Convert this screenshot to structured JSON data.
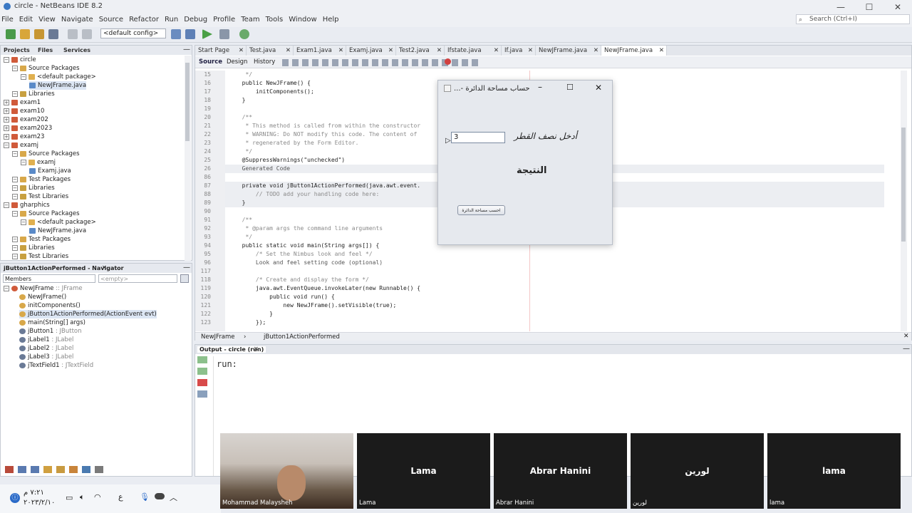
{
  "window": {
    "title": "circle - NetBeans IDE 8.2"
  },
  "menu": [
    "File",
    "Edit",
    "View",
    "Navigate",
    "Source",
    "Refactor",
    "Run",
    "Debug",
    "Profile",
    "Team",
    "Tools",
    "Window",
    "Help"
  ],
  "search": {
    "placeholder": "Search (Ctrl+I)"
  },
  "toolbar": {
    "config": "<default config>"
  },
  "projects_panel": {
    "tabs": [
      "Projects",
      "Files",
      "Services"
    ],
    "items": [
      {
        "label": "circle",
        "indent": 0,
        "icon": "project-icon"
      },
      {
        "label": "Source Packages",
        "indent": 1,
        "icon": "folder-icon"
      },
      {
        "label": "<default package>",
        "indent": 2,
        "icon": "package-icon"
      },
      {
        "label": "NewJFrame.java",
        "indent": 3,
        "icon": "java-file-icon",
        "selected": true
      },
      {
        "label": "Libraries",
        "indent": 1,
        "icon": "library-icon"
      },
      {
        "label": "exam1",
        "indent": 0,
        "icon": "project-icon"
      },
      {
        "label": "exam10",
        "indent": 0,
        "icon": "project-icon"
      },
      {
        "label": "exam202",
        "indent": 0,
        "icon": "project-icon"
      },
      {
        "label": "exam2023",
        "indent": 0,
        "icon": "project-icon"
      },
      {
        "label": "exam23",
        "indent": 0,
        "icon": "project-icon"
      },
      {
        "label": "examj",
        "indent": 0,
        "icon": "project-icon"
      },
      {
        "label": "Source Packages",
        "indent": 1,
        "icon": "folder-icon"
      },
      {
        "label": "examj",
        "indent": 2,
        "icon": "package-icon"
      },
      {
        "label": "Examj.java",
        "indent": 3,
        "icon": "java-file-icon"
      },
      {
        "label": "Test Packages",
        "indent": 1,
        "icon": "folder-icon"
      },
      {
        "label": "Libraries",
        "indent": 1,
        "icon": "library-icon"
      },
      {
        "label": "Test Libraries",
        "indent": 1,
        "icon": "library-icon"
      },
      {
        "label": "gharphics",
        "indent": 0,
        "icon": "project-icon"
      },
      {
        "label": "Source Packages",
        "indent": 1,
        "icon": "folder-icon"
      },
      {
        "label": "<default package>",
        "indent": 2,
        "icon": "package-icon"
      },
      {
        "label": "NewJFrame.java",
        "indent": 3,
        "icon": "java-file-icon"
      },
      {
        "label": "Test Packages",
        "indent": 1,
        "icon": "folder-icon"
      },
      {
        "label": "Libraries",
        "indent": 1,
        "icon": "library-icon"
      },
      {
        "label": "Test Libraries",
        "indent": 1,
        "icon": "library-icon"
      }
    ]
  },
  "navigator": {
    "title": "jButton1ActionPerformed - Navigator",
    "filter": "Members",
    "empty": "<empty>",
    "items": [
      {
        "label": "NewJFrame",
        "type": " :: JFrame",
        "indent": 0
      },
      {
        "label": "NewJFrame()",
        "type": "",
        "indent": 1
      },
      {
        "label": "initComponents()",
        "type": "",
        "indent": 1
      },
      {
        "label": "jButton1ActionPerformed(ActionEvent evt)",
        "type": "",
        "indent": 1,
        "selected": true
      },
      {
        "label": "main(String[] args)",
        "type": "",
        "indent": 1
      },
      {
        "label": "jButton1",
        "type": " : JButton",
        "indent": 1
      },
      {
        "label": "jLabel1",
        "type": " : JLabel",
        "indent": 1
      },
      {
        "label": "jLabel2",
        "type": " : JLabel",
        "indent": 1
      },
      {
        "label": "jLabel3",
        "type": " : JLabel",
        "indent": 1
      },
      {
        "label": "jTextField1",
        "type": " : JTextField",
        "indent": 1
      }
    ]
  },
  "editor": {
    "tabs": [
      "Start Page",
      "Test.java",
      "Exam1.java",
      "Examj.java",
      "Test2.java",
      "Ifstate.java",
      "If.java",
      "NewJFrame.java",
      "NewJFrame.java"
    ],
    "subtabs": [
      "Source",
      "Design",
      "History"
    ],
    "lines": [
      {
        "n": "15",
        "text": "   */"
      },
      {
        "n": "16",
        "text": "  public NewJFrame() {"
      },
      {
        "n": "17",
        "text": "      initComponents();"
      },
      {
        "n": "18",
        "text": "  }"
      },
      {
        "n": "19",
        "text": ""
      },
      {
        "n": "20",
        "text": "  /**"
      },
      {
        "n": "21",
        "text": "   * This method is called from within the constructor"
      },
      {
        "n": "22",
        "text": "   * WARNING: Do NOT modify this code. The content of"
      },
      {
        "n": "23",
        "text": "   * regenerated by the Form Editor."
      },
      {
        "n": "24",
        "text": "   */"
      },
      {
        "n": "25",
        "text": "  @SuppressWarnings(\"unchecked\")"
      },
      {
        "n": "26",
        "text": "  Generated Code"
      },
      {
        "n": "86",
        "text": ""
      },
      {
        "n": "87",
        "text": "  private void jButton1ActionPerformed(java.awt.event."
      },
      {
        "n": "88",
        "text": "      // TODO add your handling code here:"
      },
      {
        "n": "89",
        "text": "  }"
      },
      {
        "n": "90",
        "text": ""
      },
      {
        "n": "91",
        "text": "  /**"
      },
      {
        "n": "92",
        "text": "   * @param args the command line arguments"
      },
      {
        "n": "93",
        "text": "   */"
      },
      {
        "n": "94",
        "text": "  public static void main(String args[]) {"
      },
      {
        "n": "95",
        "text": "      /* Set the Nimbus look and feel */"
      },
      {
        "n": "96",
        "text": "      Look and feel setting code (optional)"
      },
      {
        "n": "117",
        "text": ""
      },
      {
        "n": "118",
        "text": "      /* Create and display the form */"
      },
      {
        "n": "119",
        "text": "      java.awt.EventQueue.invokeLater(new Runnable() {"
      },
      {
        "n": "120",
        "text": "          public void run() {"
      },
      {
        "n": "121",
        "text": "              new NewJFrame().setVisible(true);"
      },
      {
        "n": "122",
        "text": "          }"
      },
      {
        "n": "123",
        "text": "      });"
      }
    ],
    "breadcrumb": [
      "NewJFrame",
      "jButton1ActionPerformed"
    ]
  },
  "dialog": {
    "title": "حساب مساحة الدائرة -...",
    "label_radius": "أدخل نصف القطر",
    "input_value": "3",
    "label_result": "النتيجة",
    "button": "احسب مساحة الدائرة"
  },
  "output": {
    "title": "Output - circle (run)",
    "text": "run:"
  },
  "participants": [
    {
      "name": "Mohammad Malaysheh",
      "caption": "Mohammad Malaysheh",
      "video": true
    },
    {
      "name": "Lama",
      "caption": "Lama"
    },
    {
      "name": "Abrar Hanini",
      "caption": "Abrar Hanini"
    },
    {
      "name": "لورين",
      "caption": "لورين"
    },
    {
      "name": "lama",
      "caption": "lama"
    }
  ],
  "taskbar": {
    "time": "٧:٢١ م",
    "date": "٢٠٢٣/٢/١٠",
    "lang": "ع"
  }
}
